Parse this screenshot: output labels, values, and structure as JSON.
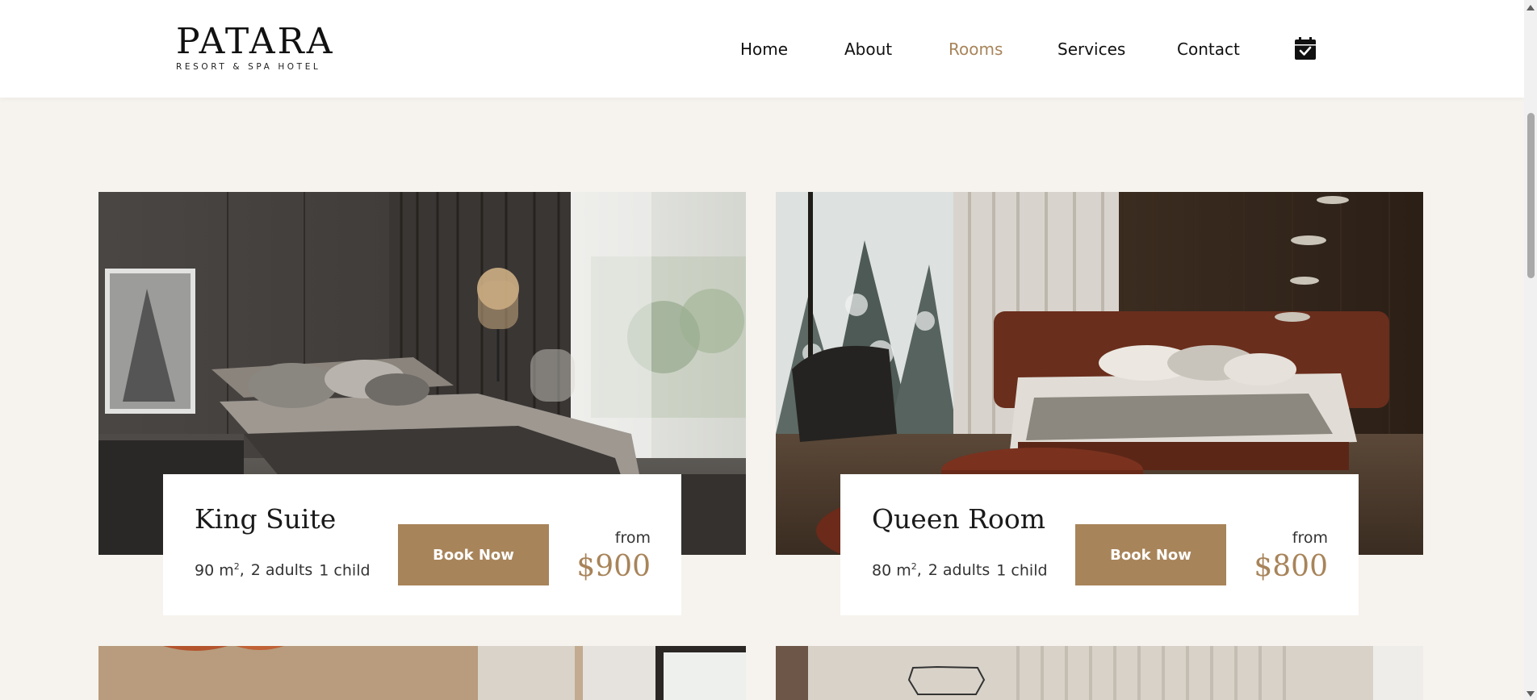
{
  "brand": {
    "name": "PATARA",
    "tagline": "RESORT & SPA HOTEL"
  },
  "nav": {
    "items": [
      {
        "label": "Home"
      },
      {
        "label": "About"
      },
      {
        "label": "Rooms",
        "active": true
      },
      {
        "label": "Services"
      },
      {
        "label": "Contact"
      }
    ],
    "booking_icon": "calendar-check-icon"
  },
  "colors": {
    "accent": "#a8845a",
    "background": "#f6f3ee",
    "header": "#ffffff"
  },
  "rooms": [
    {
      "name": "King Suite",
      "area": "90 m",
      "area_unit_sup": "2",
      "adults": "2 adults",
      "children": "1 child",
      "button": "Book Now",
      "from": "from",
      "price": "$900"
    },
    {
      "name": "Queen Room",
      "area": "80 m",
      "area_unit_sup": "2",
      "adults": "2 adults",
      "children": "1 child",
      "button": "Book Now",
      "from": "from",
      "price": "$800"
    }
  ]
}
